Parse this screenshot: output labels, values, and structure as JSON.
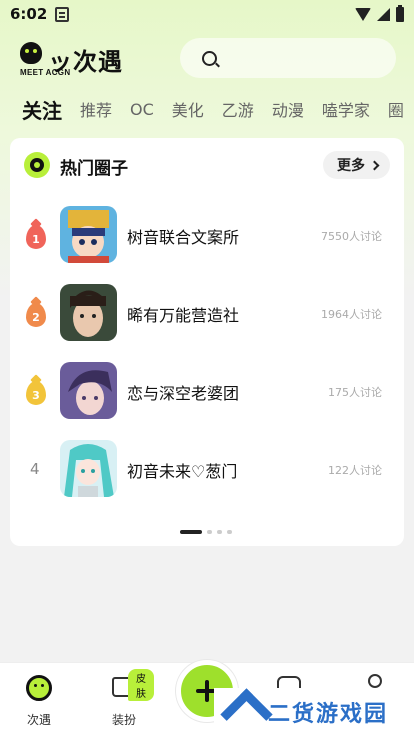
{
  "status_bar": {
    "time": "6:02"
  },
  "header": {
    "logo_main": "ッ次遇",
    "logo_sub": "MEET ACGN"
  },
  "tabs": [
    {
      "label": "关注",
      "active": true
    },
    {
      "label": "推荐"
    },
    {
      "label": "OC"
    },
    {
      "label": "美化"
    },
    {
      "label": "乙游"
    },
    {
      "label": "动漫"
    },
    {
      "label": "嗑学家"
    },
    {
      "label": "圈"
    }
  ],
  "hot_circles": {
    "title": "热门圈子",
    "more_label": "更多",
    "items": [
      {
        "rank": "1",
        "name": "树音联合文案所",
        "count": "7550人讨论",
        "rank_color": "#f0645a"
      },
      {
        "rank": "2",
        "name": "晞有万能营造社",
        "count": "1964人讨论",
        "rank_color": "#f08a4b"
      },
      {
        "rank": "3",
        "name": "恋与深空老婆团",
        "count": "175人讨论",
        "rank_color": "#f2c43a"
      },
      {
        "rank": "4",
        "name": "初音未来♡葱门",
        "count": "122人讨论"
      }
    ]
  },
  "bottom_nav": {
    "home_label": "次遇",
    "outfit_label": "装扮",
    "skin_badge": "皮肤"
  },
  "watermark": {
    "text": "二货游戏园"
  },
  "colors": {
    "accent": "#b8ef3a",
    "fab": "#9ee02c",
    "watermark": "#2b6fc7"
  }
}
